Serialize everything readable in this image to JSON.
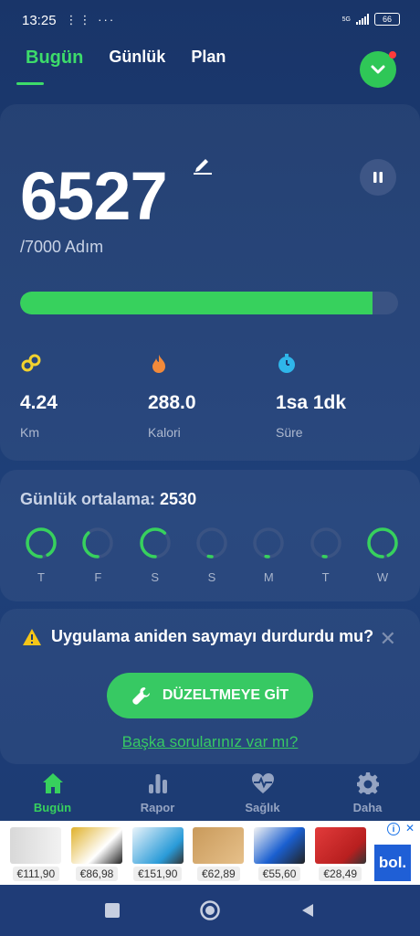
{
  "status_bar": {
    "time": "13:25",
    "left_icons": "⋮⋮ ···",
    "network": "5G",
    "battery": "66"
  },
  "tabs": [
    {
      "label": "Bugün",
      "active": true
    },
    {
      "label": "Günlük",
      "active": false
    },
    {
      "label": "Plan",
      "active": false
    }
  ],
  "today": {
    "steps": "6527",
    "goal": "/7000 Adım",
    "progress": 0.9324,
    "stats": [
      {
        "value": "4.24",
        "unit": "Km",
        "icon": "distance-icon",
        "color": "#f2d22e"
      },
      {
        "value": "288.0",
        "unit": "Kalori",
        "icon": "flame-icon",
        "color": "#f28a3a"
      },
      {
        "value": "1sa 1dk",
        "unit": "Süre",
        "icon": "timer-icon",
        "color": "#2fb6ea"
      }
    ]
  },
  "weekly": {
    "title_label": "Günlük ortalama:",
    "average": "2530",
    "days": [
      {
        "label": "T",
        "fraction": 0.92
      },
      {
        "label": "F",
        "fraction": 0.38
      },
      {
        "label": "S",
        "fraction": 0.62
      },
      {
        "label": "S",
        "fraction": 0.04
      },
      {
        "label": "M",
        "fraction": 0.03
      },
      {
        "label": "T",
        "fraction": 0.03
      },
      {
        "label": "W",
        "fraction": 0.93
      }
    ]
  },
  "alert": {
    "title": "Uygulama aniden saymayı durdurdu mu?",
    "button": "DÜZELTMEYE GİT",
    "link": "Başka sorularınız var mı?"
  },
  "bottom_nav": [
    {
      "label": "Bugün",
      "icon": "home-icon",
      "active": true
    },
    {
      "label": "Rapor",
      "icon": "bar-chart-icon",
      "active": false
    },
    {
      "label": "Sağlık",
      "icon": "heart-pulse-icon",
      "active": false
    },
    {
      "label": "Daha",
      "icon": "gear-icon",
      "active": false
    }
  ],
  "ad": {
    "prices": [
      "€111,90",
      "€86,98",
      "€151,90",
      "€62,89",
      "€55,60",
      "€28,49"
    ],
    "logo": "bol.",
    "info": "i"
  },
  "colors": {
    "accent": "#37d15d",
    "background": "#1c3a70",
    "track": "#3a5383"
  }
}
